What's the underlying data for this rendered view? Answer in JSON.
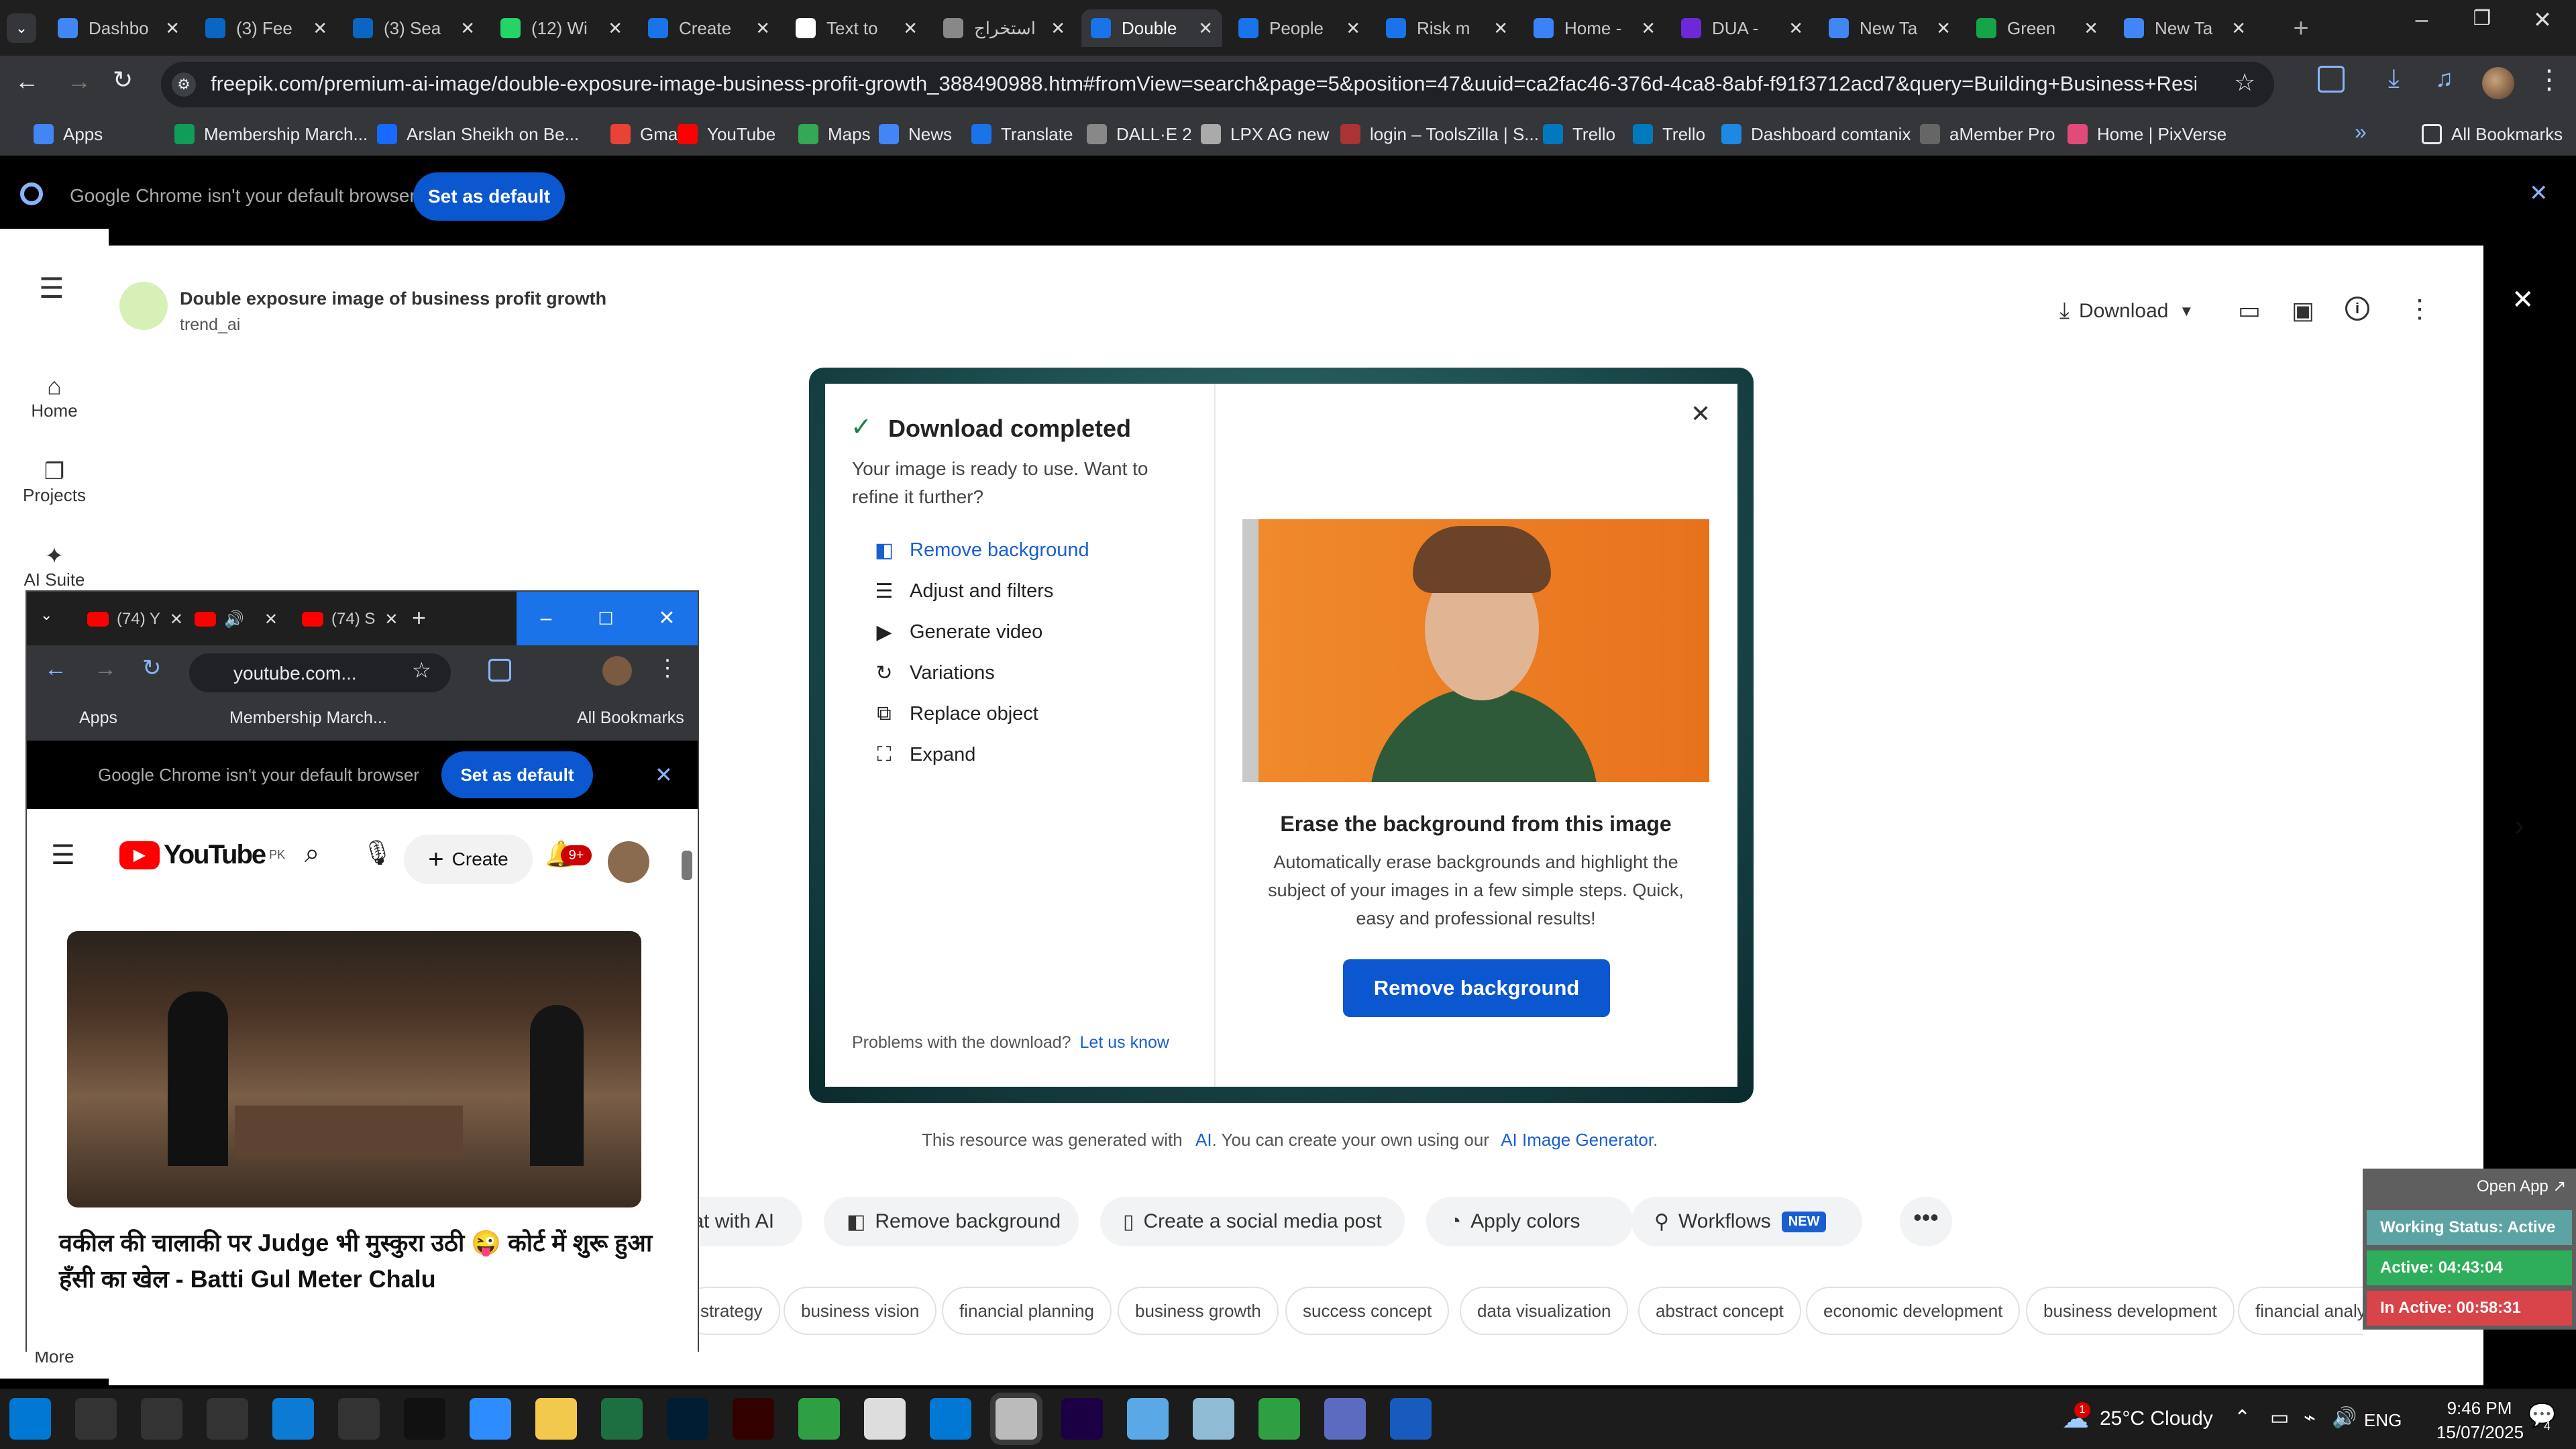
{
  "browser": {
    "tabs": [
      {
        "label": "Dashbo",
        "color": "#4285f4"
      },
      {
        "label": "(3) Fee",
        "color": "#0a66c2"
      },
      {
        "label": "(3) Sea",
        "color": "#0a66c2"
      },
      {
        "label": "(12) Wi",
        "color": "#25d366"
      },
      {
        "label": "Create",
        "color": "#1a73e8"
      },
      {
        "label": "Text to",
        "color": "#ffffff"
      },
      {
        "label": "استخراج",
        "color": "#888888"
      },
      {
        "label": "Double",
        "color": "#1a73e8"
      },
      {
        "label": "People",
        "color": "#1a73e8"
      },
      {
        "label": "Risk m",
        "color": "#1a73e8"
      },
      {
        "label": "Home -",
        "color": "#3b82f6"
      },
      {
        "label": "DUA -",
        "color": "#6d28d9"
      },
      {
        "label": "New Ta",
        "color": "#4285f4"
      },
      {
        "label": "Green",
        "color": "#16a34a"
      },
      {
        "label": "New Ta",
        "color": "#4285f4"
      }
    ],
    "url": "freepik.com/premium-ai-image/double-exposure-image-business-profit-growth_388490988.htm#fromView=search&page=5&position=47&uuid=ca2fac46-376d-4ca8-8abf-f91f3712acd7&query=Building+Business+Resilience+Through+Gove...",
    "bookmarks": [
      {
        "label": "Apps"
      },
      {
        "label": "Membership March..."
      },
      {
        "label": "Arslan Sheikh on Be..."
      },
      {
        "label": "Gmail"
      },
      {
        "label": "YouTube"
      },
      {
        "label": "Maps"
      },
      {
        "label": "News"
      },
      {
        "label": "Translate"
      },
      {
        "label": "DALL·E 2"
      },
      {
        "label": "LPX AG new"
      },
      {
        "label": "login – ToolsZilla | S..."
      },
      {
        "label": "Trello"
      },
      {
        "label": "Trello"
      },
      {
        "label": "Dashboard comtanix"
      },
      {
        "label": "aMember Pro"
      },
      {
        "label": "Home | PixVerse"
      }
    ],
    "all_bookmarks": "All Bookmarks",
    "infobar": {
      "text": "Google Chrome isn't your default browser",
      "button": "Set as default"
    }
  },
  "freepik": {
    "nav": {
      "home": "Home",
      "projects": "Projects",
      "ai_suite": "AI Suite",
      "more": "More"
    },
    "title": "Double exposure image of business profit growth",
    "author": "trend_ai",
    "download_label": "Download",
    "modal": {
      "heading": "Download completed",
      "subtext": "Your image is ready to use. Want to refine it further?",
      "options": [
        "Remove background",
        "Adjust and filters",
        "Generate video",
        "Variations",
        "Replace object",
        "Expand"
      ],
      "problems_text": "Problems with the download?",
      "problems_link": "Let us know",
      "promo_title": "Erase the background from this image",
      "promo_desc": "Automatically erase backgrounds and highlight the subject of your images in a few simple steps. Quick, easy and professional results!",
      "promo_button": "Remove background"
    },
    "notice": {
      "pre": "This resource was generated with",
      "ai_link": "AI",
      "mid": ". You can create your own using our",
      "gen_link": "AI Image Generator",
      "post": "."
    },
    "actions": [
      "Chat with AI",
      "Remove background",
      "Create a social media post",
      "Apply colors",
      "Workflows"
    ],
    "new_badge": "NEW",
    "tags": [
      "strategy",
      "business vision",
      "financial planning",
      "business growth",
      "success concept",
      "data visualization",
      "abstract concept",
      "economic development",
      "business development",
      "financial analy"
    ]
  },
  "youtube_window": {
    "tabs": [
      "(74) Y",
      "",
      "(74) S"
    ],
    "url": "youtube.com...",
    "bookmarks": {
      "apps": "Apps",
      "membership": "Membership March...",
      "all": "All Bookmarks"
    },
    "infobar": {
      "text": "Google Chrome isn't your default browser",
      "button": "Set as default"
    },
    "logo": "YouTube",
    "region": "PK",
    "create": "Create",
    "notif_count": "9+",
    "video_title": "वकील की चालाकी पर Judge भी मुस्कुरा उठी 😜 कोर्ट में शुरू हुआ हँसी का खेल - Batti Gul Meter Chalu"
  },
  "status_widget": {
    "open_app": "Open App ↗",
    "working": "Working Status: Active",
    "active": "Active: 04:43:04",
    "inactive": "In Active: 00:58:31"
  },
  "taskbar": {
    "weather": "25°C  Cloudy",
    "weather_badge": "1",
    "lang": "ENG",
    "time": "9:46 PM",
    "date": "15/07/2025",
    "notif": "4"
  }
}
